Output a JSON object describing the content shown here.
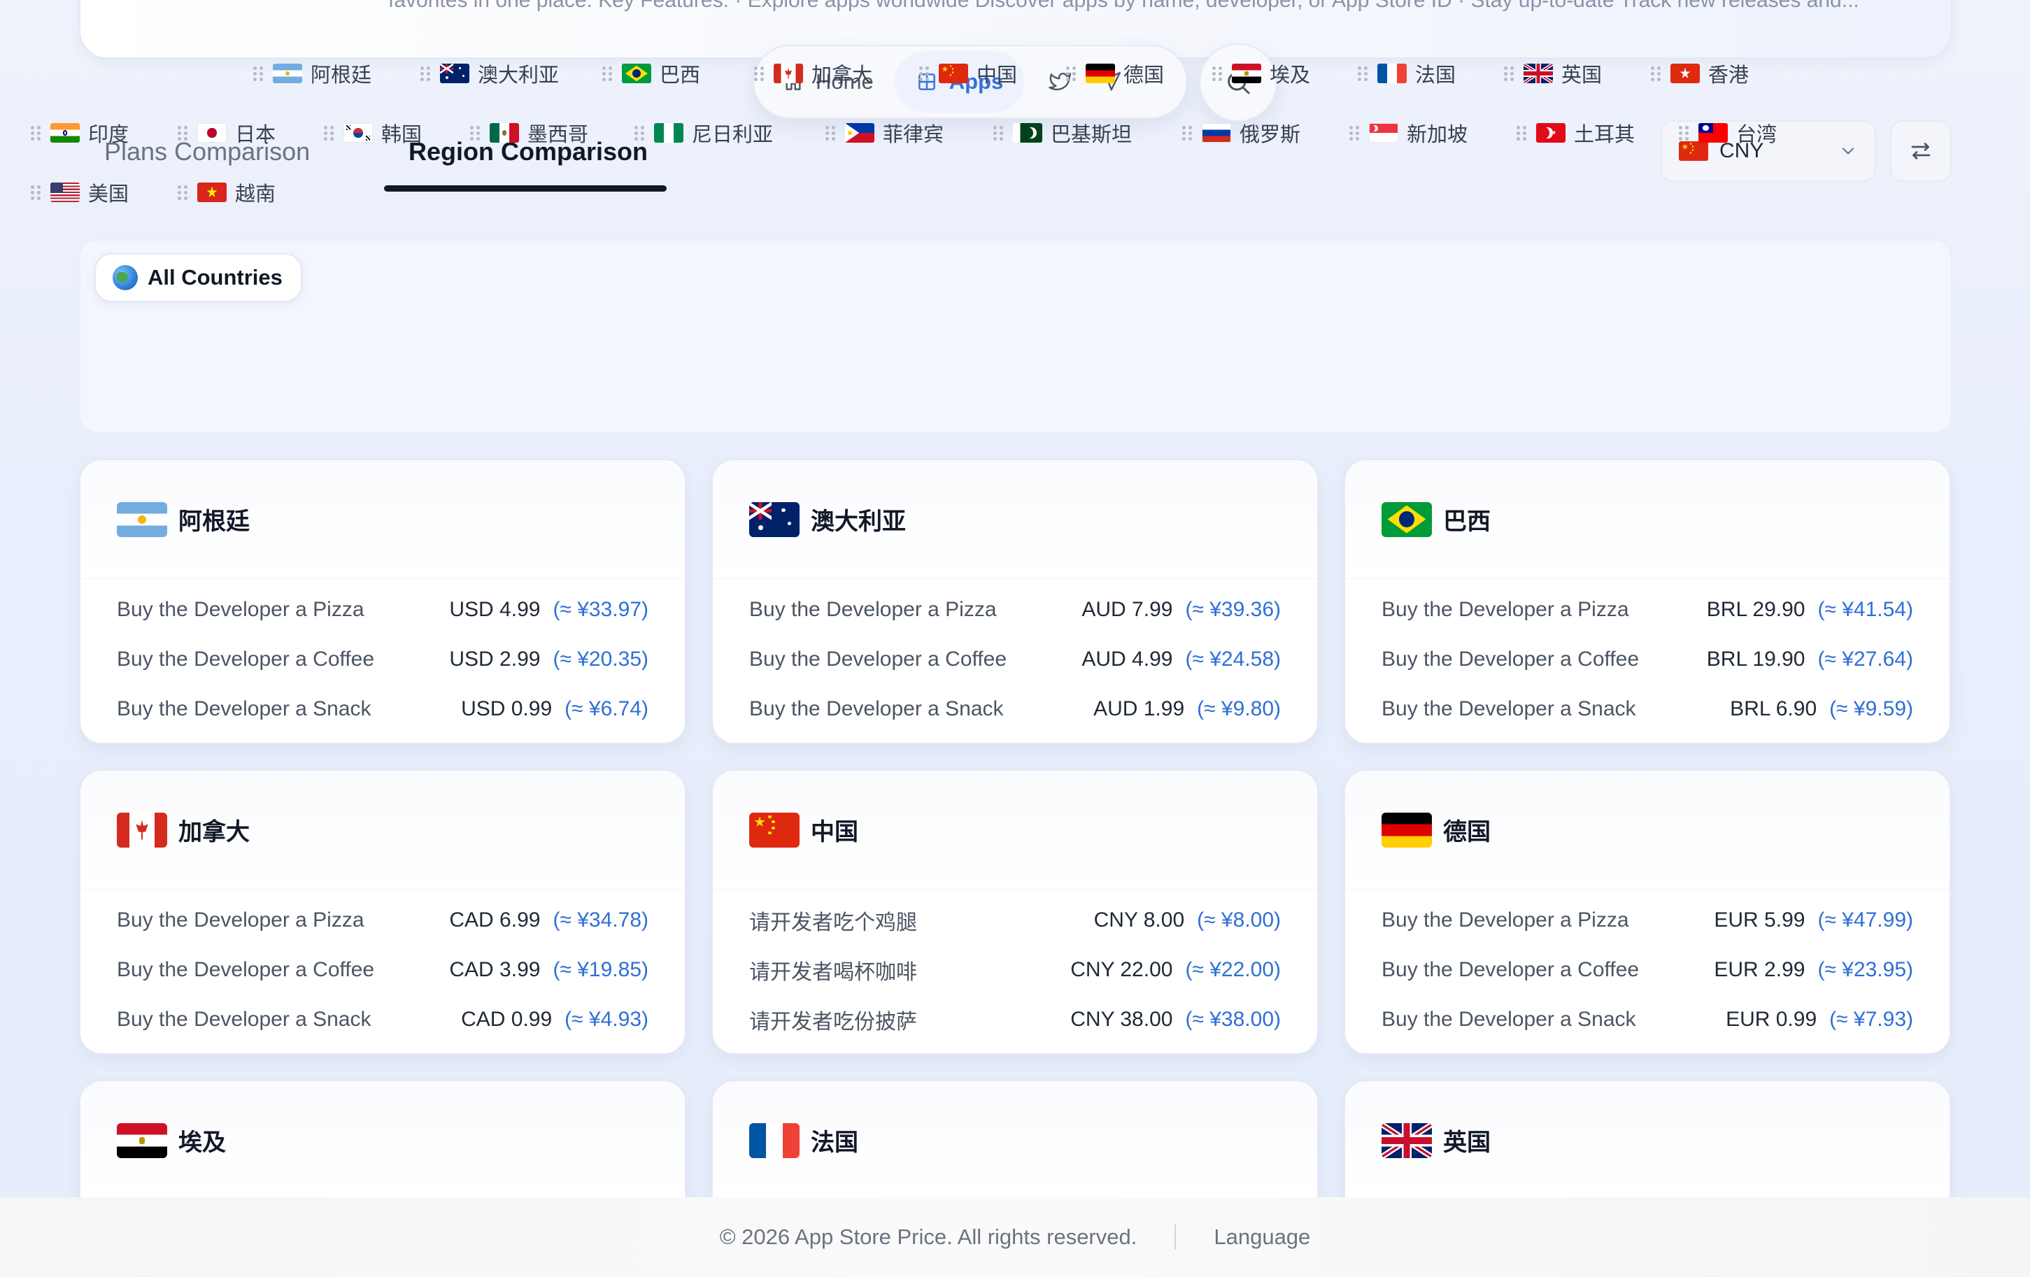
{
  "hero": {
    "description": "favorites in one place. Key Features: · Explore apps worldwide Discover apps by name, developer, or App Store ID · Stay up-to-date Track new releases and..."
  },
  "nav": {
    "home_label": "Home",
    "apps_label": "Apps"
  },
  "tabs": {
    "plans": "Plans Comparison",
    "region": "Region Comparison"
  },
  "currency": {
    "selected": "CNY"
  },
  "filters": {
    "all_label": "All Countries",
    "countries": [
      {
        "code": "ar",
        "name": "阿根廷"
      },
      {
        "code": "au",
        "name": "澳大利亚"
      },
      {
        "code": "br",
        "name": "巴西"
      },
      {
        "code": "ca",
        "name": "加拿大"
      },
      {
        "code": "cn",
        "name": "中国"
      },
      {
        "code": "de",
        "name": "德国"
      },
      {
        "code": "eg",
        "name": "埃及"
      },
      {
        "code": "fr",
        "name": "法国"
      },
      {
        "code": "gb",
        "name": "英国"
      },
      {
        "code": "hk",
        "name": "香港"
      },
      {
        "code": "in",
        "name": "印度"
      },
      {
        "code": "jp",
        "name": "日本"
      },
      {
        "code": "kr",
        "name": "韩国"
      },
      {
        "code": "mx",
        "name": "墨西哥"
      },
      {
        "code": "ng",
        "name": "尼日利亚"
      },
      {
        "code": "ph",
        "name": "菲律宾"
      },
      {
        "code": "pk",
        "name": "巴基斯坦"
      },
      {
        "code": "ru",
        "name": "俄罗斯"
      },
      {
        "code": "sg",
        "name": "新加坡"
      },
      {
        "code": "tr",
        "name": "土耳其"
      },
      {
        "code": "tw",
        "name": "台湾"
      },
      {
        "code": "us",
        "name": "美国"
      },
      {
        "code": "vn",
        "name": "越南"
      }
    ]
  },
  "cards": [
    {
      "code": "ar",
      "name": "阿根廷",
      "rows": [
        {
          "label": "Buy the Developer a Pizza",
          "price": "USD 4.99",
          "conv": "(≈ ¥33.97)"
        },
        {
          "label": "Buy the Developer a Coffee",
          "price": "USD 2.99",
          "conv": "(≈ ¥20.35)"
        },
        {
          "label": "Buy the Developer a Snack",
          "price": "USD 0.99",
          "conv": "(≈ ¥6.74)"
        }
      ]
    },
    {
      "code": "au",
      "name": "澳大利亚",
      "rows": [
        {
          "label": "Buy the Developer a Pizza",
          "price": "AUD 7.99",
          "conv": "(≈ ¥39.36)"
        },
        {
          "label": "Buy the Developer a Coffee",
          "price": "AUD 4.99",
          "conv": "(≈ ¥24.58)"
        },
        {
          "label": "Buy the Developer a Snack",
          "price": "AUD 1.99",
          "conv": "(≈ ¥9.80)"
        }
      ]
    },
    {
      "code": "br",
      "name": "巴西",
      "rows": [
        {
          "label": "Buy the Developer a Pizza",
          "price": "BRL 29.90",
          "conv": "(≈ ¥41.54)"
        },
        {
          "label": "Buy the Developer a Coffee",
          "price": "BRL 19.90",
          "conv": "(≈ ¥27.64)"
        },
        {
          "label": "Buy the Developer a Snack",
          "price": "BRL 6.90",
          "conv": "(≈ ¥9.59)"
        }
      ]
    },
    {
      "code": "ca",
      "name": "加拿大",
      "rows": [
        {
          "label": "Buy the Developer a Pizza",
          "price": "CAD 6.99",
          "conv": "(≈ ¥34.78)"
        },
        {
          "label": "Buy the Developer a Coffee",
          "price": "CAD 3.99",
          "conv": "(≈ ¥19.85)"
        },
        {
          "label": "Buy the Developer a Snack",
          "price": "CAD 0.99",
          "conv": "(≈ ¥4.93)"
        }
      ]
    },
    {
      "code": "cn",
      "name": "中国",
      "rows": [
        {
          "label": "请开发者吃个鸡腿",
          "price": "CNY 8.00",
          "conv": "(≈ ¥8.00)"
        },
        {
          "label": "请开发者喝杯咖啡",
          "price": "CNY 22.00",
          "conv": "(≈ ¥22.00)"
        },
        {
          "label": "请开发者吃份披萨",
          "price": "CNY 38.00",
          "conv": "(≈ ¥38.00)"
        }
      ]
    },
    {
      "code": "de",
      "name": "德国",
      "rows": [
        {
          "label": "Buy the Developer a Pizza",
          "price": "EUR 5.99",
          "conv": "(≈ ¥47.99)"
        },
        {
          "label": "Buy the Developer a Coffee",
          "price": "EUR 2.99",
          "conv": "(≈ ¥23.95)"
        },
        {
          "label": "Buy the Developer a Snack",
          "price": "EUR 0.99",
          "conv": "(≈ ¥7.93)"
        }
      ]
    },
    {
      "code": "eg",
      "name": "埃及",
      "rows": []
    },
    {
      "code": "fr",
      "name": "法国",
      "rows": []
    },
    {
      "code": "gb",
      "name": "英国",
      "rows": []
    }
  ],
  "footer": {
    "copyright": "© 2026 App Store Price. All rights reserved.",
    "language": "Language"
  },
  "colors": {
    "accent": "#2f6fd6",
    "active_nav_bg": "#edf2fd"
  }
}
